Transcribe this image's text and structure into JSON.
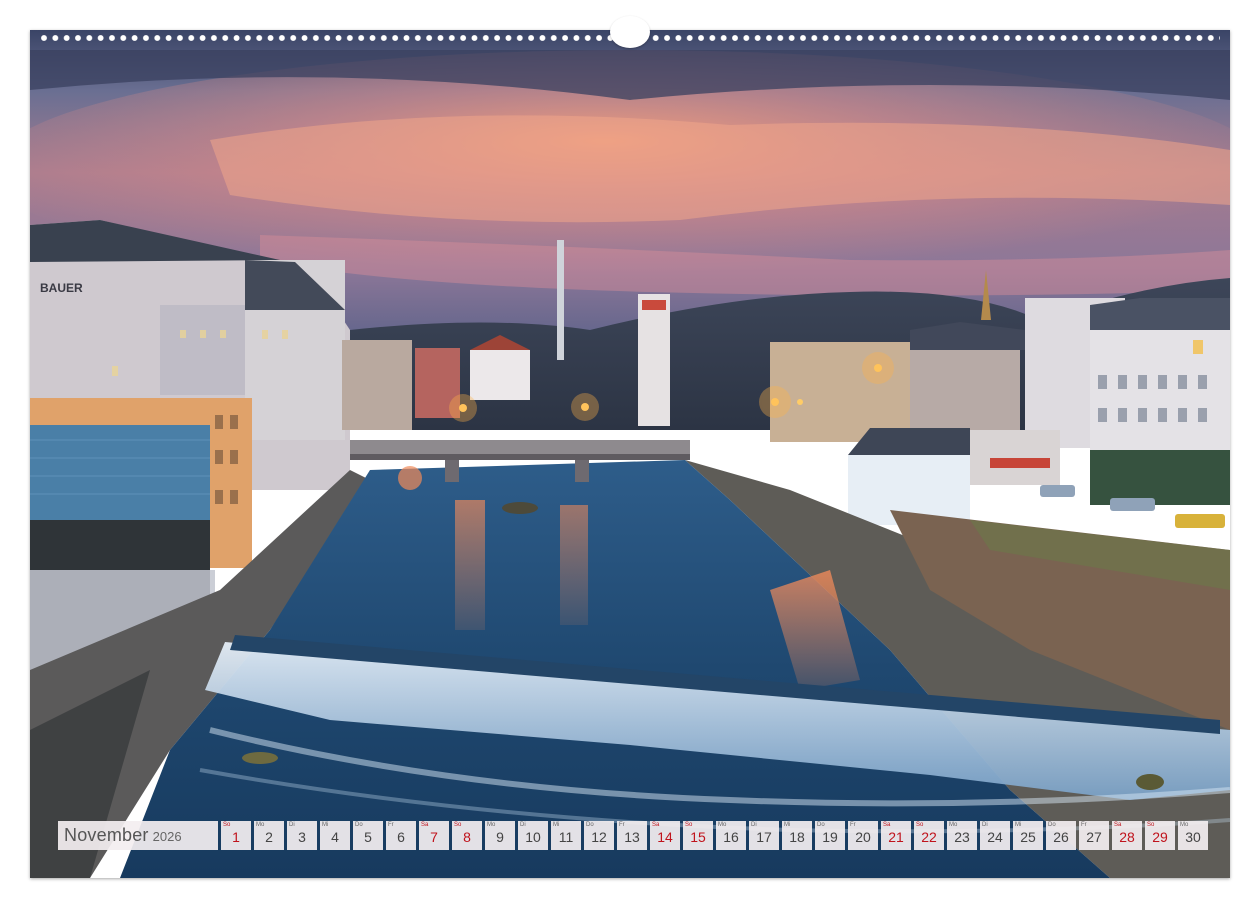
{
  "calendar": {
    "month": "November",
    "year": "2026",
    "days": [
      {
        "wd": "So",
        "num": "1",
        "weekend": true
      },
      {
        "wd": "Mo",
        "num": "2",
        "weekend": false
      },
      {
        "wd": "Di",
        "num": "3",
        "weekend": false
      },
      {
        "wd": "Mi",
        "num": "4",
        "weekend": false
      },
      {
        "wd": "Do",
        "num": "5",
        "weekend": false
      },
      {
        "wd": "Fr",
        "num": "6",
        "weekend": false
      },
      {
        "wd": "Sa",
        "num": "7",
        "weekend": true
      },
      {
        "wd": "So",
        "num": "8",
        "weekend": true
      },
      {
        "wd": "Mo",
        "num": "9",
        "weekend": false
      },
      {
        "wd": "Di",
        "num": "10",
        "weekend": false
      },
      {
        "wd": "Mi",
        "num": "11",
        "weekend": false
      },
      {
        "wd": "Do",
        "num": "12",
        "weekend": false
      },
      {
        "wd": "Fr",
        "num": "13",
        "weekend": false
      },
      {
        "wd": "Sa",
        "num": "14",
        "weekend": true
      },
      {
        "wd": "So",
        "num": "15",
        "weekend": true
      },
      {
        "wd": "Mo",
        "num": "16",
        "weekend": false
      },
      {
        "wd": "Di",
        "num": "17",
        "weekend": false
      },
      {
        "wd": "Mi",
        "num": "18",
        "weekend": false
      },
      {
        "wd": "Do",
        "num": "19",
        "weekend": false
      },
      {
        "wd": "Fr",
        "num": "20",
        "weekend": false
      },
      {
        "wd": "Sa",
        "num": "21",
        "weekend": true
      },
      {
        "wd": "So",
        "num": "22",
        "weekend": true
      },
      {
        "wd": "Mo",
        "num": "23",
        "weekend": false
      },
      {
        "wd": "Di",
        "num": "24",
        "weekend": false
      },
      {
        "wd": "Mi",
        "num": "25",
        "weekend": false
      },
      {
        "wd": "Do",
        "num": "26",
        "weekend": false
      },
      {
        "wd": "Fr",
        "num": "27",
        "weekend": false
      },
      {
        "wd": "Sa",
        "num": "28",
        "weekend": true
      },
      {
        "wd": "So",
        "num": "29",
        "weekend": true
      },
      {
        "wd": "Mo",
        "num": "30",
        "weekend": false
      }
    ]
  },
  "photo": {
    "building_sign": "BAUER"
  },
  "colors": {
    "weekend": "#c0131c",
    "weekday": "#444444",
    "cell_bg": "#f3eef0"
  }
}
